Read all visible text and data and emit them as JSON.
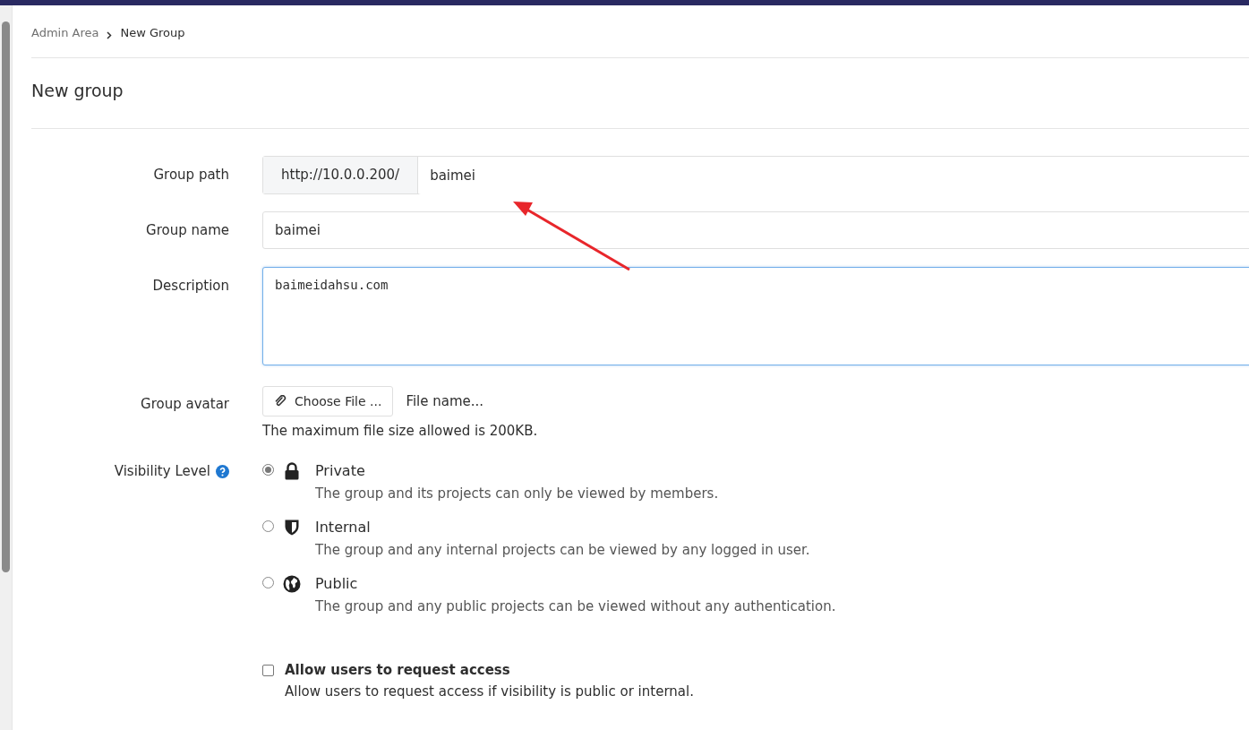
{
  "breadcrumb": [
    {
      "label": "Admin Area",
      "current": false
    },
    {
      "label": "New Group",
      "current": true
    }
  ],
  "page_title": "New group",
  "form": {
    "group_path": {
      "label": "Group path",
      "prefix": "http://10.0.0.200/",
      "value": "baimei"
    },
    "group_name": {
      "label": "Group name",
      "value": "baimei"
    },
    "description": {
      "label": "Description",
      "value": "baimeidahsu.com"
    },
    "avatar": {
      "label": "Group avatar",
      "button": "Choose File ...",
      "file_name": "File name...",
      "hint": "The maximum file size allowed is 200KB."
    },
    "visibility": {
      "label": "Visibility Level",
      "options": [
        {
          "kind": "lock",
          "label": "Private",
          "description": "The group and its projects can only be viewed by members.",
          "selected": true
        },
        {
          "kind": "shield",
          "label": "Internal",
          "description": "The group and any internal projects can be viewed by any logged in user.",
          "selected": false
        },
        {
          "kind": "globe",
          "label": "Public",
          "description": "The group and any public projects can be viewed without any authentication.",
          "selected": false
        }
      ]
    },
    "request_access": {
      "label": "Allow users to request access",
      "description": "Allow users to request access if visibility is public or internal.",
      "checked": false
    }
  }
}
